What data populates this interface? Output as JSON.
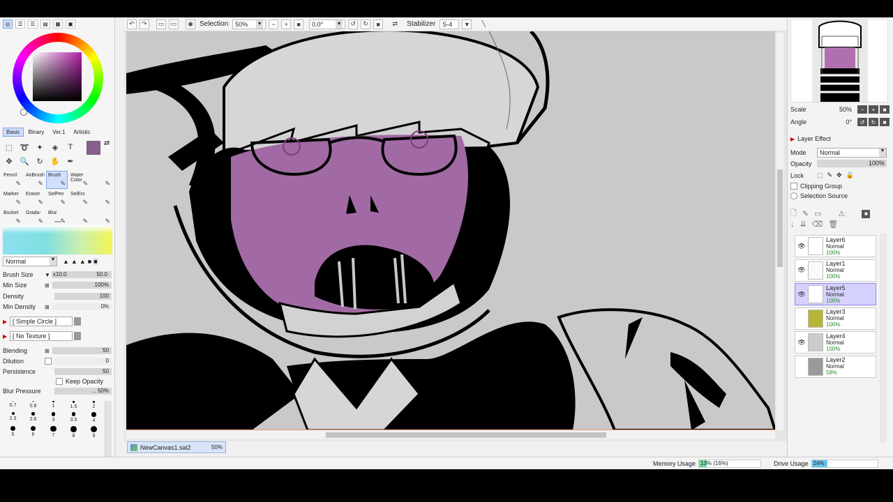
{
  "toolbar": {
    "selection_label": "Selection",
    "zoom": "50%",
    "rotation": "0.0°",
    "stabilizer_label": "Stabilizer",
    "stabilizer_value": "S-4"
  },
  "left": {
    "mode_tabs": [
      "Basic",
      "Binary",
      "Ver.1",
      "Artistic"
    ],
    "current_color": "#8a5f8f",
    "brushes": [
      {
        "label": "Pencil"
      },
      {
        "label": "AirBrush"
      },
      {
        "label": "Brush",
        "active": true
      },
      {
        "label": "Water Color"
      },
      {
        "label": ""
      },
      {
        "label": "Marker"
      },
      {
        "label": "Eraser"
      },
      {
        "label": "SelPen"
      },
      {
        "label": "SelErs"
      },
      {
        "label": ""
      },
      {
        "label": "Bucket"
      },
      {
        "label": "Grada-"
      },
      {
        "label": "Blur"
      },
      {
        "label": ""
      },
      {
        "label": ""
      }
    ],
    "blend_mode": "Normal",
    "brush_size_label": "Brush Size",
    "brush_size_mult": "x10.0",
    "brush_size_value": "50.0",
    "min_size_label": "Min Size",
    "min_size_value": "100%",
    "density_label": "Density",
    "density_value": "100",
    "min_density_label": "Min Density",
    "min_density_value": "0%",
    "shape": "[ Simple Circle ]",
    "texture": "[ No Texture ]",
    "blending_label": "Blending",
    "blending_value": "50",
    "dilution_label": "Dilution",
    "dilution_value": "0",
    "persistence_label": "Persistence",
    "persistence_value": "50",
    "keep_opacity_label": "Keep Opacity",
    "blur_pressure_label": "Blur Pressure",
    "blur_pressure_value": "... 50%",
    "size_presets": [
      "0.7",
      "0.8",
      "1",
      "1.5",
      "2",
      "2.3",
      "2.6",
      "3",
      "3.5",
      "4",
      "5",
      "6",
      "7",
      "8",
      "9"
    ]
  },
  "file_tab": {
    "name": "NewCanvas1.sai2",
    "zoom": "50%"
  },
  "right": {
    "scale_label": "Scale",
    "scale_value": "50%",
    "angle_label": "Angle",
    "angle_value": "0°",
    "layer_effect_label": "Layer Effect",
    "mode_label": "Mode",
    "mode_value": "Normal",
    "opacity_label": "Opacity",
    "opacity_value": "100%",
    "lock_label": "Lock",
    "clipping_label": "Clipping Group",
    "selection_source_label": "Selection Source",
    "layers": [
      {
        "name": "Layer6",
        "mode": "Normal",
        "opacity": "100%",
        "visible": true,
        "selected": false
      },
      {
        "name": "Layer1",
        "mode": "Normal",
        "opacity": "100%",
        "visible": true,
        "selected": false
      },
      {
        "name": "Layer5",
        "mode": "Normal",
        "opacity": "100%",
        "visible": true,
        "selected": true
      },
      {
        "name": "Layer3",
        "mode": "Normal",
        "opacity": "100%",
        "visible": false,
        "selected": false
      },
      {
        "name": "Layer4",
        "mode": "Normal",
        "opacity": "100%",
        "visible": true,
        "selected": false
      },
      {
        "name": "Layer2",
        "mode": "Normal",
        "opacity": "58%",
        "visible": false,
        "selected": false
      }
    ]
  },
  "status": {
    "memory_label": "Memory Usage",
    "memory_value": "13% (16%)",
    "memory_fraction": 0.13,
    "drive_label": "Drive Usage",
    "drive_value": "24%",
    "drive_fraction": 0.24
  }
}
